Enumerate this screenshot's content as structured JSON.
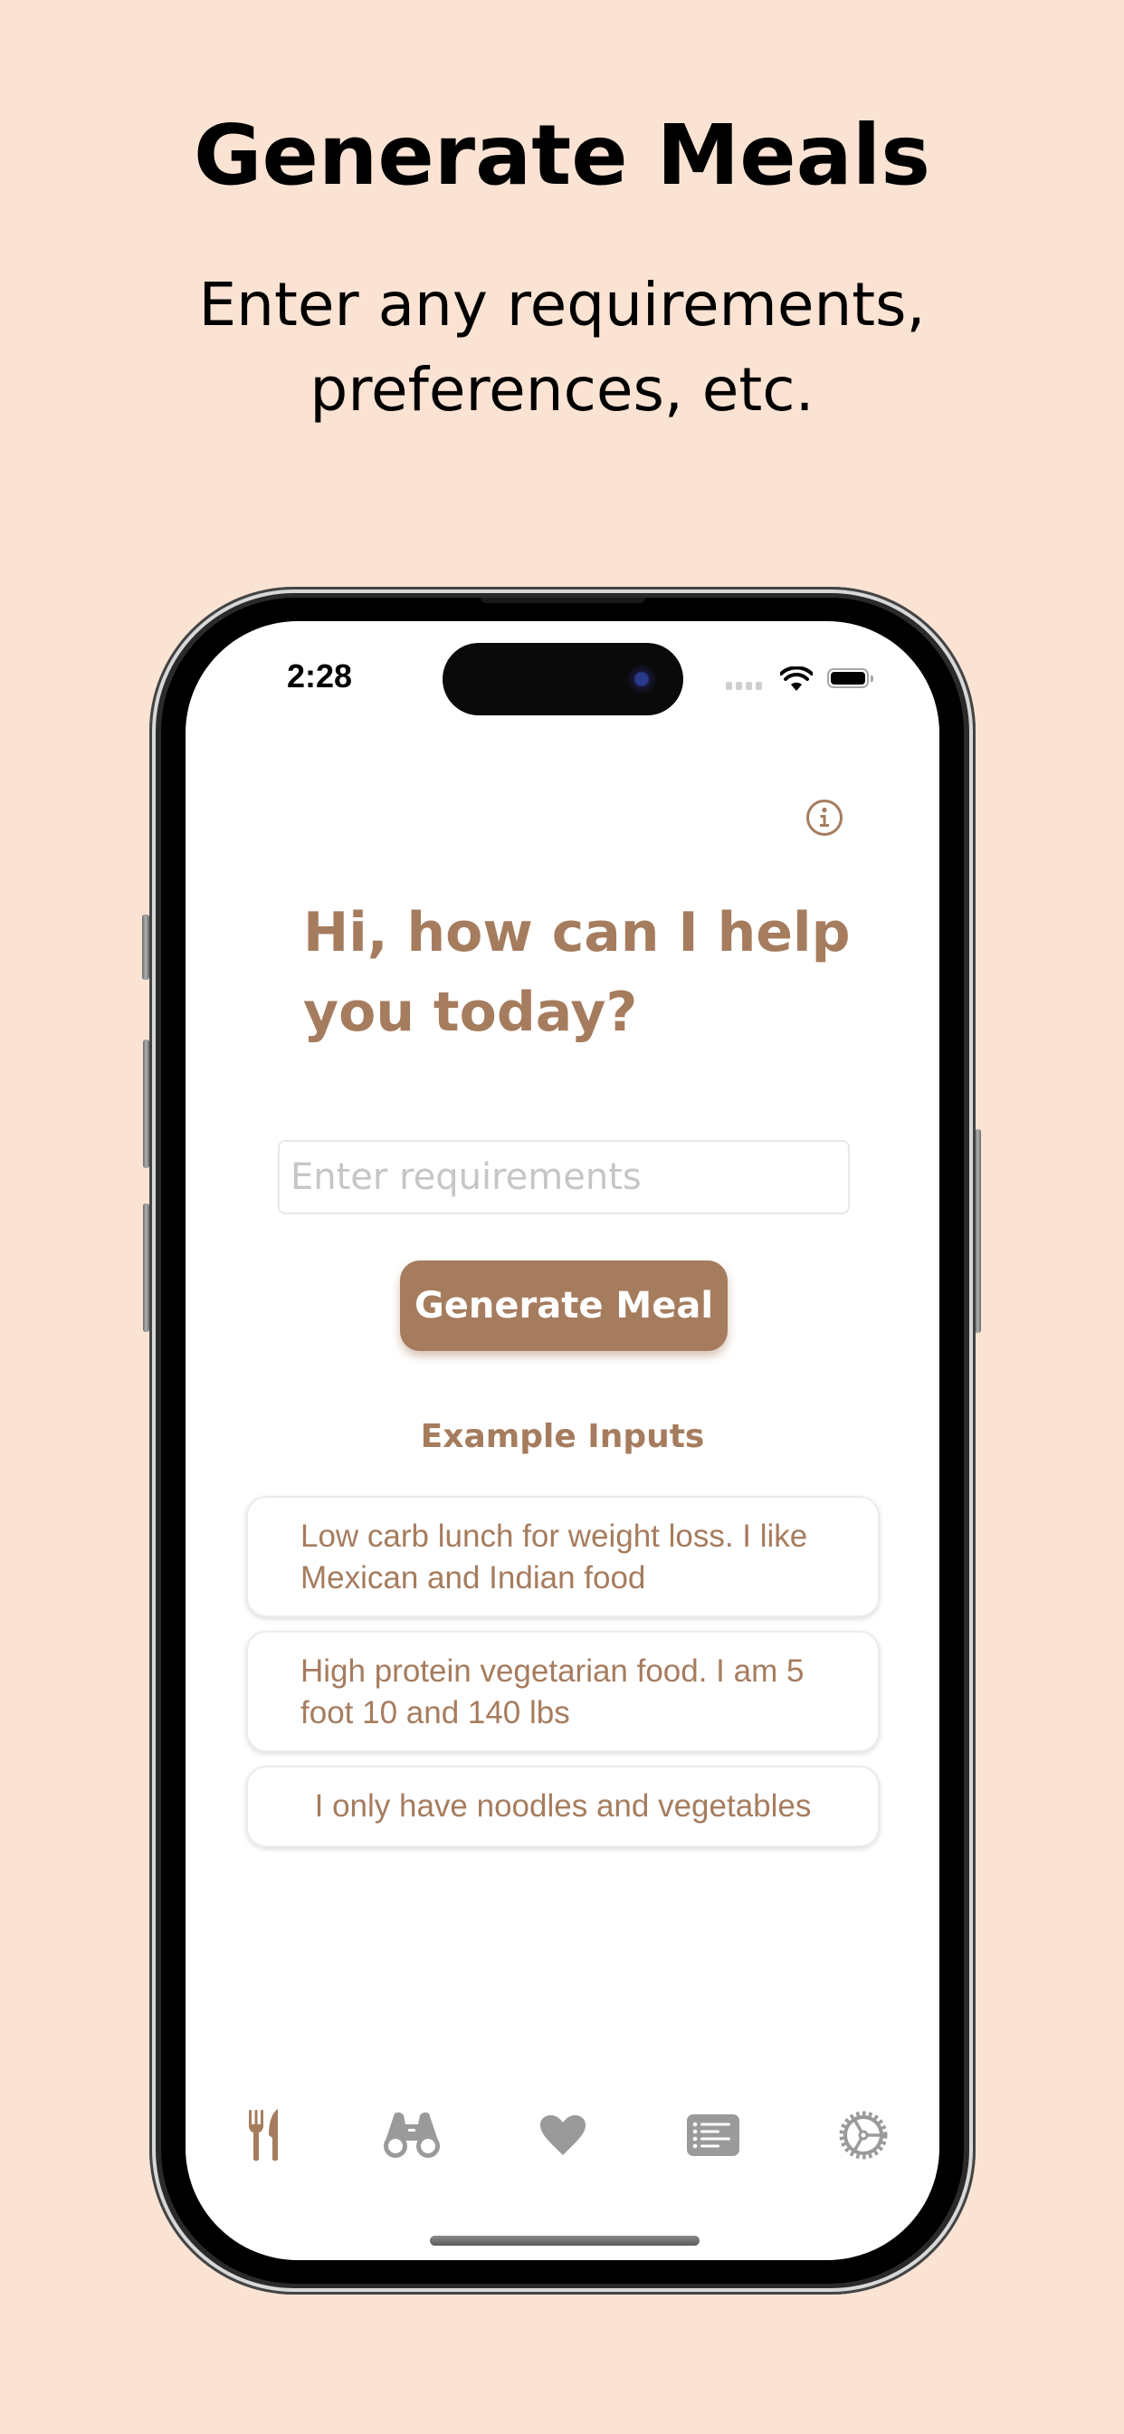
{
  "promo": {
    "title": "Generate Meals",
    "subtitle_line1": "Enter any requirements,",
    "subtitle_line2": "preferences, etc."
  },
  "status_bar": {
    "time": "2:28",
    "icons": [
      "cellular-signal-icon",
      "wifi-icon",
      "battery-icon"
    ]
  },
  "header": {
    "info_icon": "info-icon"
  },
  "main": {
    "greeting": "Hi, how can I help you today?",
    "input": {
      "value": "",
      "placeholder": "Enter requirements"
    },
    "generate_button_label": "Generate Meal",
    "examples_title": "Example Inputs",
    "examples": [
      "Low carb lunch for weight loss. I like Mexican and Indian food",
      "High protein vegetarian food. I am 5 foot 10 and 140 lbs",
      "I only have noodles and vegetables"
    ]
  },
  "tab_bar": {
    "active_index": 0,
    "tabs": [
      {
        "icon": "fork-knife-icon",
        "name": "generate"
      },
      {
        "icon": "binoculars-icon",
        "name": "explore"
      },
      {
        "icon": "heart-icon",
        "name": "favorites"
      },
      {
        "icon": "list-icon",
        "name": "list"
      },
      {
        "icon": "settings-gear-icon",
        "name": "settings"
      }
    ]
  },
  "colors": {
    "background": "#fbe3d4",
    "accent": "#a67c5e",
    "inactive_icon": "#9a9a9a",
    "placeholder": "#c6c6c8"
  }
}
